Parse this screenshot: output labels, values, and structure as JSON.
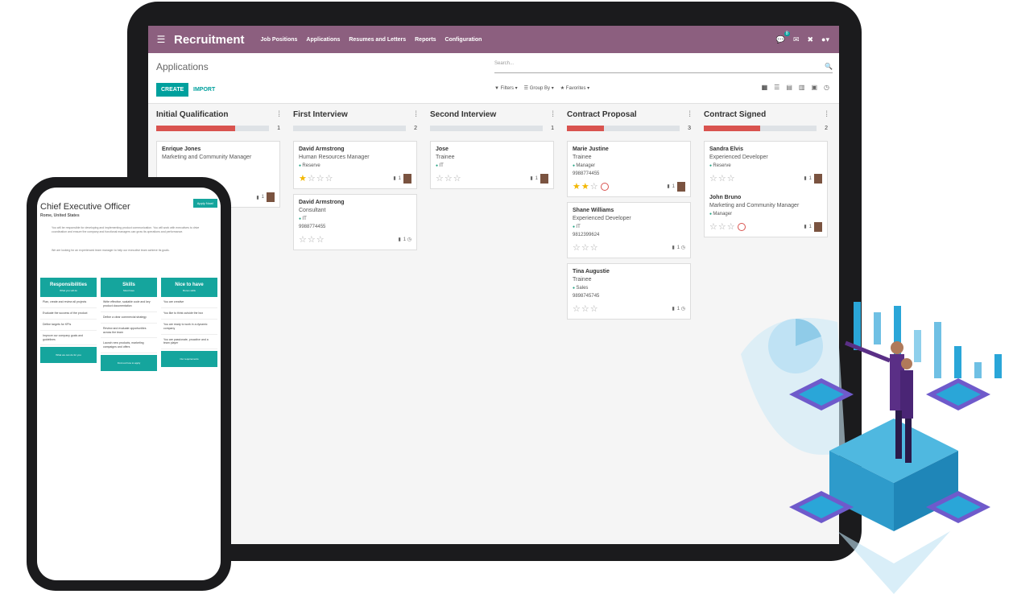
{
  "app": {
    "title": "Recruitment",
    "nav": [
      "Job Positions",
      "Applications",
      "Resumes and Letters",
      "Reports",
      "Configuration"
    ],
    "notif_count": "8"
  },
  "control": {
    "breadcrumb": "Applications",
    "create_label": "CREATE",
    "import_label": "IMPORT",
    "search_placeholder": "Search...",
    "filters": [
      "Filters",
      "Group By",
      "Favorites"
    ]
  },
  "columns": [
    {
      "title": "Initial Qualification",
      "count": "1",
      "progress_fraction": 0.7,
      "cards": [
        {
          "name": "Enrique Jones",
          "job": "Marketing and Community Manager",
          "tag": "",
          "phone": "",
          "stars": 0
        }
      ]
    },
    {
      "title": "First Interview",
      "count": "2",
      "progress_fraction": 0,
      "cards": [
        {
          "name": "David Armstrong",
          "job": "Human Resources Manager",
          "tag": "Reserve",
          "phone": "",
          "stars": 1
        },
        {
          "name": "David Armstrong",
          "job": "Consultant",
          "tag": "IT",
          "phone": "9988774455",
          "stars": 0
        }
      ]
    },
    {
      "title": "Second Interview",
      "count": "1",
      "progress_fraction": 0,
      "cards": [
        {
          "name": "Jose",
          "job": "Trainee",
          "tag": "IT",
          "phone": "",
          "stars": 0
        }
      ]
    },
    {
      "title": "Contract Proposal",
      "count": "3",
      "progress_fraction": 0.33,
      "cards": [
        {
          "name": "Marie Justine",
          "job": "Trainee",
          "tag": "Manager",
          "phone": "9988774455",
          "stars": 2
        },
        {
          "name": "Shane Williams",
          "job": "Experienced Developer",
          "tag": "IT",
          "phone": "9812399624",
          "stars": 0
        },
        {
          "name": "Tina Augustie",
          "job": "Trainee",
          "tag": "Sales",
          "phone": "9898745745",
          "stars": 0
        }
      ]
    },
    {
      "title": "Contract Signed",
      "count": "2",
      "progress_fraction": 0.5,
      "cards": [
        {
          "name": "Sandra Elvis",
          "job": "Experienced Developer",
          "tag": "Reserve",
          "phone": "",
          "stars": 0
        },
        {
          "name": "John Bruno",
          "job": "Marketing and Community Manager",
          "tag": "Manager",
          "phone": "",
          "stars": 0
        }
      ]
    }
  ],
  "phone": {
    "title": "Chief Executive Officer",
    "location": "Rome, United States",
    "apply_label": "Apply Now!",
    "paragraph1": "You will be responsible for developing and implementing product communication. You will work with executives to drive coordination and ensure the company and functional managers can grow its operations and performance.",
    "paragraph2": "We are looking for an experienced team manager to help our executive team achieve its goals.",
    "columns": [
      {
        "title": "Responsibilities",
        "subtitle": "What you will do",
        "items": [
          "Plan, create and review all projects",
          "Evaluate the success of the product",
          "Define targets for KPIs",
          "Improve our company goals and guidelines"
        ],
        "footer": "What we can do for you"
      },
      {
        "title": "Skills",
        "subtitle": "Must have",
        "items": [
          "Write effective, scalable code and key product documentation",
          "Define a clear commercial strategy",
          "Review and evaluate opportunities across the team",
          "Launch new products, marketing campaigns and offers"
        ],
        "footer": "Find out how to apply"
      },
      {
        "title": "Nice to have",
        "subtitle": "Bonus skills",
        "items": [
          "You are creative",
          "You like to think outside the box",
          "You are ready to work in a dynamic company",
          "You are passionate, proactive and a team player"
        ],
        "footer": "Our requirements"
      }
    ]
  }
}
